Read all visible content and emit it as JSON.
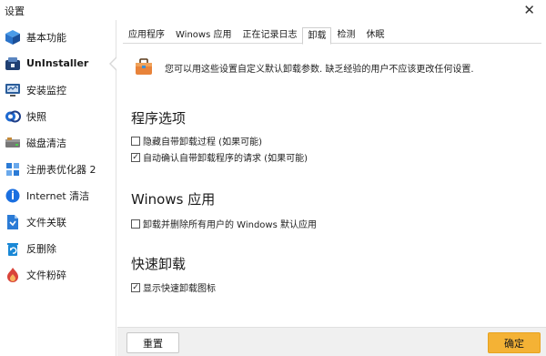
{
  "window": {
    "title": "设置",
    "close_glyph": "✕"
  },
  "sidebar": {
    "items": [
      {
        "label": "基本功能",
        "icon": "cube-icon",
        "color": "#2a73c9",
        "active": false
      },
      {
        "label": "UnInstaller",
        "icon": "uninstaller-icon",
        "color": "#1f3f73",
        "active": true
      },
      {
        "label": "安装监控",
        "icon": "monitor-icon",
        "color": "#2b5d9a",
        "active": false
      },
      {
        "label": "快照",
        "icon": "snapshot-icon",
        "color": "#1e6ad2",
        "active": false
      },
      {
        "label": "磁盘清洁",
        "icon": "disk-icon",
        "color": "#666666",
        "active": false
      },
      {
        "label": "注册表优化器 2",
        "icon": "registry-icon",
        "color": "#2b7bd6",
        "active": false
      },
      {
        "label": "Internet 清洁",
        "icon": "internet-icon",
        "color": "#1a6fe0",
        "active": false
      },
      {
        "label": "文件关联",
        "icon": "file-link-icon",
        "color": "#2b7bd6",
        "active": false
      },
      {
        "label": "反删除",
        "icon": "undelete-icon",
        "color": "#1a88d6",
        "active": false
      },
      {
        "label": "文件粉碎",
        "icon": "shredder-icon",
        "color": "#d9443a",
        "active": false
      }
    ]
  },
  "tabs": [
    {
      "label": "应用程序",
      "active": false
    },
    {
      "label": "Winows 应用",
      "active": false
    },
    {
      "label": "正在记录日志",
      "active": false
    },
    {
      "label": "卸载",
      "active": true
    },
    {
      "label": "检测",
      "active": false
    },
    {
      "label": "休眠",
      "active": false
    }
  ],
  "info": {
    "text": "您可以用这些设置自定义默认卸载参数. 缺乏经验的用户不应该更改任何设置.",
    "icon": "briefcase-icon"
  },
  "sections": {
    "program": {
      "title": "程序选项",
      "options": [
        {
          "label": "隐藏自带卸载过程 (如果可能)",
          "checked": false
        },
        {
          "label": "自动确认自带卸载程序的请求 (如果可能)",
          "checked": true
        }
      ]
    },
    "windows_apps": {
      "title": "Winows 应用",
      "options": [
        {
          "label": "卸载并删除所有用户的 Windows 默认应用",
          "checked": false
        }
      ]
    },
    "quick": {
      "title": "快速卸载",
      "options": [
        {
          "label": "显示快速卸载图标",
          "checked": true
        }
      ]
    }
  },
  "buttons": {
    "reset": "重置",
    "ok": "确定"
  },
  "colors": {
    "accent": "#f4b235",
    "bottom_bar": "#f0f0f0"
  }
}
